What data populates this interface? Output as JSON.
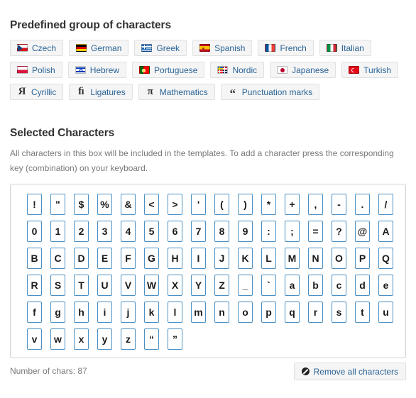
{
  "predefined": {
    "title": "Predefined group of characters",
    "rows": [
      [
        {
          "label": "Czech",
          "icon": "flag-czech-icon",
          "icon_kind": "flag",
          "flag": "cz"
        },
        {
          "label": "German",
          "icon": "flag-german-icon",
          "icon_kind": "flag",
          "flag": "de"
        },
        {
          "label": "Greek",
          "icon": "flag-greek-icon",
          "icon_kind": "flag",
          "flag": "gr"
        },
        {
          "label": "Spanish",
          "icon": "flag-spanish-icon",
          "icon_kind": "flag",
          "flag": "es"
        },
        {
          "label": "French",
          "icon": "flag-french-icon",
          "icon_kind": "flag",
          "flag": "fr"
        },
        {
          "label": "Italian",
          "icon": "flag-italian-icon",
          "icon_kind": "flag",
          "flag": "it"
        }
      ],
      [
        {
          "label": "Polish",
          "icon": "flag-polish-icon",
          "icon_kind": "flag",
          "flag": "pl"
        },
        {
          "label": "Hebrew",
          "icon": "flag-israel-icon",
          "icon_kind": "flag",
          "flag": "il"
        },
        {
          "label": "Portuguese",
          "icon": "flag-portuguese-icon",
          "icon_kind": "flag",
          "flag": "pt"
        },
        {
          "label": "Nordic",
          "icon": "flag-nordic-icon",
          "icon_kind": "flag",
          "flag": "nd"
        },
        {
          "label": "Japanese",
          "icon": "flag-japanese-icon",
          "icon_kind": "flag",
          "flag": "jp"
        },
        {
          "label": "Turkish",
          "icon": "flag-turkish-icon",
          "icon_kind": "flag",
          "flag": "tr"
        }
      ],
      [
        {
          "label": "Cyrillic",
          "icon": "cyrillic-ya-icon",
          "icon_kind": "glyph",
          "glyph": "Я"
        },
        {
          "label": "Ligatures",
          "icon": "ligature-fi-icon",
          "icon_kind": "glyph",
          "glyph": "ﬁ"
        },
        {
          "label": "Mathematics",
          "icon": "pi-icon",
          "icon_kind": "glyph",
          "glyph": "π"
        },
        {
          "label": "Punctuation marks",
          "icon": "double-quote-icon",
          "icon_kind": "glyph",
          "glyph": "“"
        }
      ]
    ]
  },
  "selected": {
    "title": "Selected Characters",
    "description": "All characters in this box will be included in the templates. To add a character press the corresponding key (combination) on your keyboard.",
    "char_rows": [
      [
        "!",
        "\"",
        "$",
        "%",
        "&",
        "<",
        ">",
        "'",
        "(",
        ")",
        "*",
        "+",
        ",",
        "-",
        ".",
        "/"
      ],
      [
        "0",
        "1",
        "2",
        "3",
        "4",
        "5",
        "6",
        "7",
        "8",
        "9",
        ":",
        ";",
        "=",
        "?",
        "@",
        "A"
      ],
      [
        "B",
        "C",
        "D",
        "E",
        "F",
        "G",
        "H",
        "I",
        "J",
        "K",
        "L",
        "M",
        "N",
        "O",
        "P",
        "Q"
      ],
      [
        "R",
        "S",
        "T",
        "U",
        "V",
        "W",
        "X",
        "Y",
        "Z",
        "_",
        "`",
        "a",
        "b",
        "c",
        "d",
        "e"
      ],
      [
        "f",
        "g",
        "h",
        "i",
        "j",
        "k",
        "l",
        "m",
        "n",
        "o",
        "p",
        "q",
        "r",
        "s",
        "t",
        "u"
      ],
      [
        "v",
        "w",
        "x",
        "y",
        "z",
        "“",
        "”"
      ]
    ]
  },
  "footer": {
    "count_label": "Number of chars: 87",
    "remove_label": "Remove all characters",
    "remove_icon": "ban-icon"
  },
  "colors": {
    "link": "#2a6496",
    "button_bg": "#f5f5f5",
    "button_border": "#e0e0e0",
    "cell_border": "#4a90c4",
    "heading": "#333333",
    "muted_text": "#7a7a7a",
    "box_border": "#d0d0d0"
  }
}
